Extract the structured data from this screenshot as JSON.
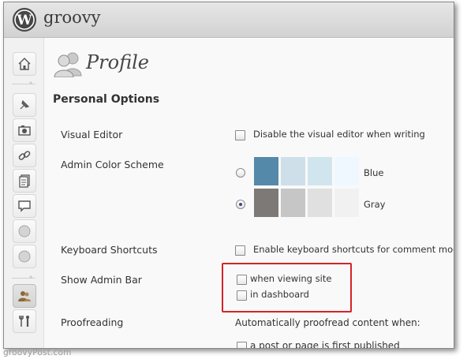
{
  "site": {
    "name": "groovy",
    "logo": "wordpress-logo"
  },
  "page": {
    "title": "Profile",
    "section_title": "Personal Options"
  },
  "visual_editor": {
    "label": "Visual Editor",
    "option": "Disable the visual editor when writing",
    "checked": false
  },
  "color_scheme": {
    "label": "Admin Color Scheme",
    "options": [
      {
        "name": "Blue",
        "selected": false,
        "colors": [
          "#5589aa",
          "#cfdfe9",
          "#d1e5ee",
          "#eff8ff"
        ]
      },
      {
        "name": "Gray",
        "selected": true,
        "colors": [
          "#7c7976",
          "#c6c6c6",
          "#e0e0e0",
          "#f1f1f1"
        ]
      }
    ]
  },
  "keyboard_shortcuts": {
    "label": "Keyboard Shortcuts",
    "option": "Enable keyboard shortcuts for comment mod",
    "checked": false
  },
  "admin_bar": {
    "label": "Show Admin Bar",
    "options": [
      {
        "label": "when viewing site",
        "checked": false
      },
      {
        "label": "in dashboard",
        "checked": false
      }
    ],
    "highlight_color": "#d42428"
  },
  "proofreading": {
    "label": "Proofreading",
    "description": "Automatically proofread content when:",
    "options": [
      {
        "label": "a post or page is first published",
        "checked": false
      }
    ]
  },
  "sidebar_icons": [
    "dashboard-icon",
    "posts-icon",
    "media-icon",
    "links-icon",
    "pages-icon",
    "comments-icon",
    "circle-icon",
    "circle-icon",
    "users-icon",
    "tools-icon"
  ],
  "watermark": "groovyPost.com"
}
